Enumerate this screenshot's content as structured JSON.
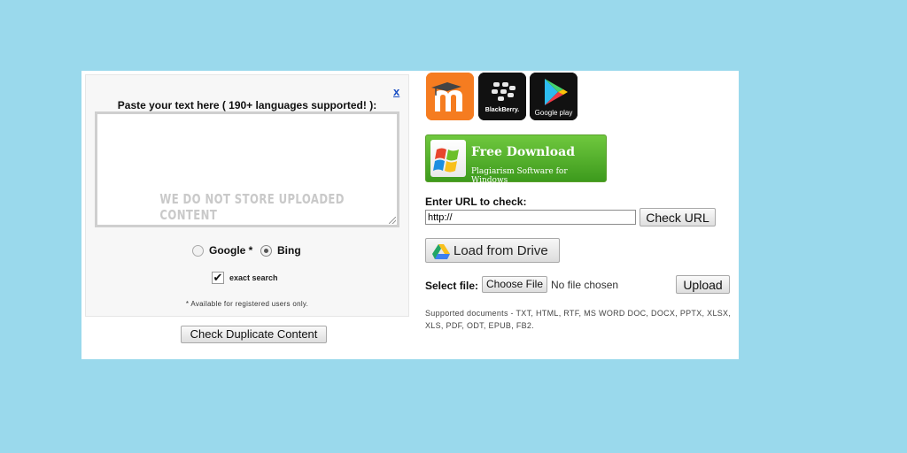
{
  "left": {
    "close": "x",
    "paste_label": "Paste your text here ( 190+ languages supported! ):",
    "textarea_value": "",
    "watermark": "WE DO NOT STORE UPLOADED CONTENT",
    "engines": [
      {
        "label": "Google *",
        "selected": false
      },
      {
        "label": "Bing",
        "selected": true
      }
    ],
    "exact_search_label": "exact search",
    "exact_search_checked": true,
    "available_note": "* Available for registered users only.",
    "check_button": "Check Duplicate Content"
  },
  "apps": [
    {
      "name": "moodle-icon",
      "text": "m"
    },
    {
      "name": "blackberry-icon",
      "text": "BlackBerry."
    },
    {
      "name": "google-play-icon",
      "text": "Google play"
    }
  ],
  "download": {
    "title": "Free Download",
    "subtitle": "Plagiarism Software for Windows"
  },
  "url": {
    "label": "Enter URL to check:",
    "value": "http://",
    "button": "Check URL"
  },
  "drive": {
    "label": "Load from Drive"
  },
  "file": {
    "label": "Select file:",
    "choose_button": "Choose File",
    "status": "No file chosen",
    "upload_button": "Upload"
  },
  "supported_docs": "Supported documents - TXT, HTML, RTF, MS WORD DOC, DOCX, PPTX, XLSX, XLS, PDF, ODT, EPUB, FB2.",
  "colors": {
    "page_background": "#9ad9ec",
    "download_green": "#4caf2a",
    "link_blue": "#1a4fc4"
  }
}
